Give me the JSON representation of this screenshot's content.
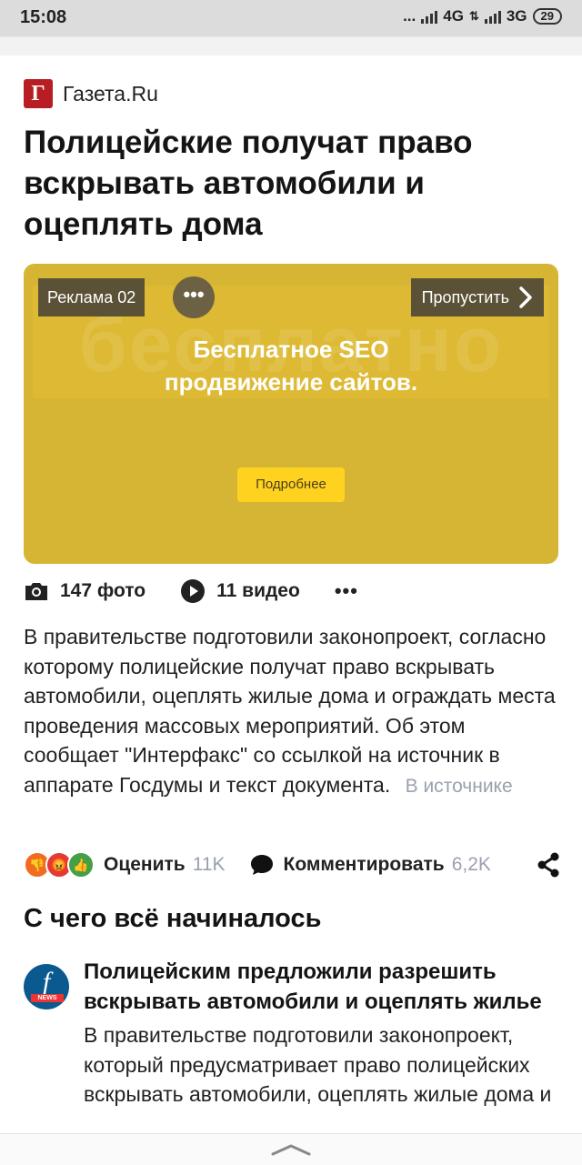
{
  "status_bar": {
    "time": "15:08",
    "dots": "...",
    "net1": "4G",
    "net2": "3G",
    "battery": "29"
  },
  "source": {
    "logo_letter": "Г",
    "name": "Газета.Ru"
  },
  "article": {
    "title": "Полицейские получат право вскрывать автомобили и оцеплять дома",
    "body": "В правительстве подготовили законопроект, согласно которому полицейские получат право вскрывать автомобили, оцеплять жилые дома и ограждать места проведения массовых мероприятий. Об этом сообщает \"Интерфакс\" со ссылкой на источник в аппарате Госдумы и текст документа.",
    "source_link": "В источнике"
  },
  "ad": {
    "label": "Реклама 02",
    "skip_label": "Пропустить",
    "watermark": "бесплатно",
    "headline_line1": "Бесплатное SEO",
    "headline_line2": "продвижение сайтов.",
    "cta": "Подробнее",
    "bg_color": "#d5b533",
    "cta_color": "#ffd21f"
  },
  "media": {
    "photos": "147 фото",
    "videos": "11 видео"
  },
  "actions": {
    "rate_label": "Оценить",
    "rate_count": "11K",
    "comment_label": "Комментировать",
    "comment_count": "6,2K"
  },
  "section": {
    "title": "С чего всё начиналось"
  },
  "story": {
    "avatar_letter": "f",
    "avatar_tag": "NEWS",
    "title": "Полицейским предложили разрешить вскрывать автомобили и оцеплять жилье",
    "text": "В правительстве подготовили законопроект, который предусматривает право полицейских вскрывать автомобили, оцеплять жилые дома и"
  }
}
